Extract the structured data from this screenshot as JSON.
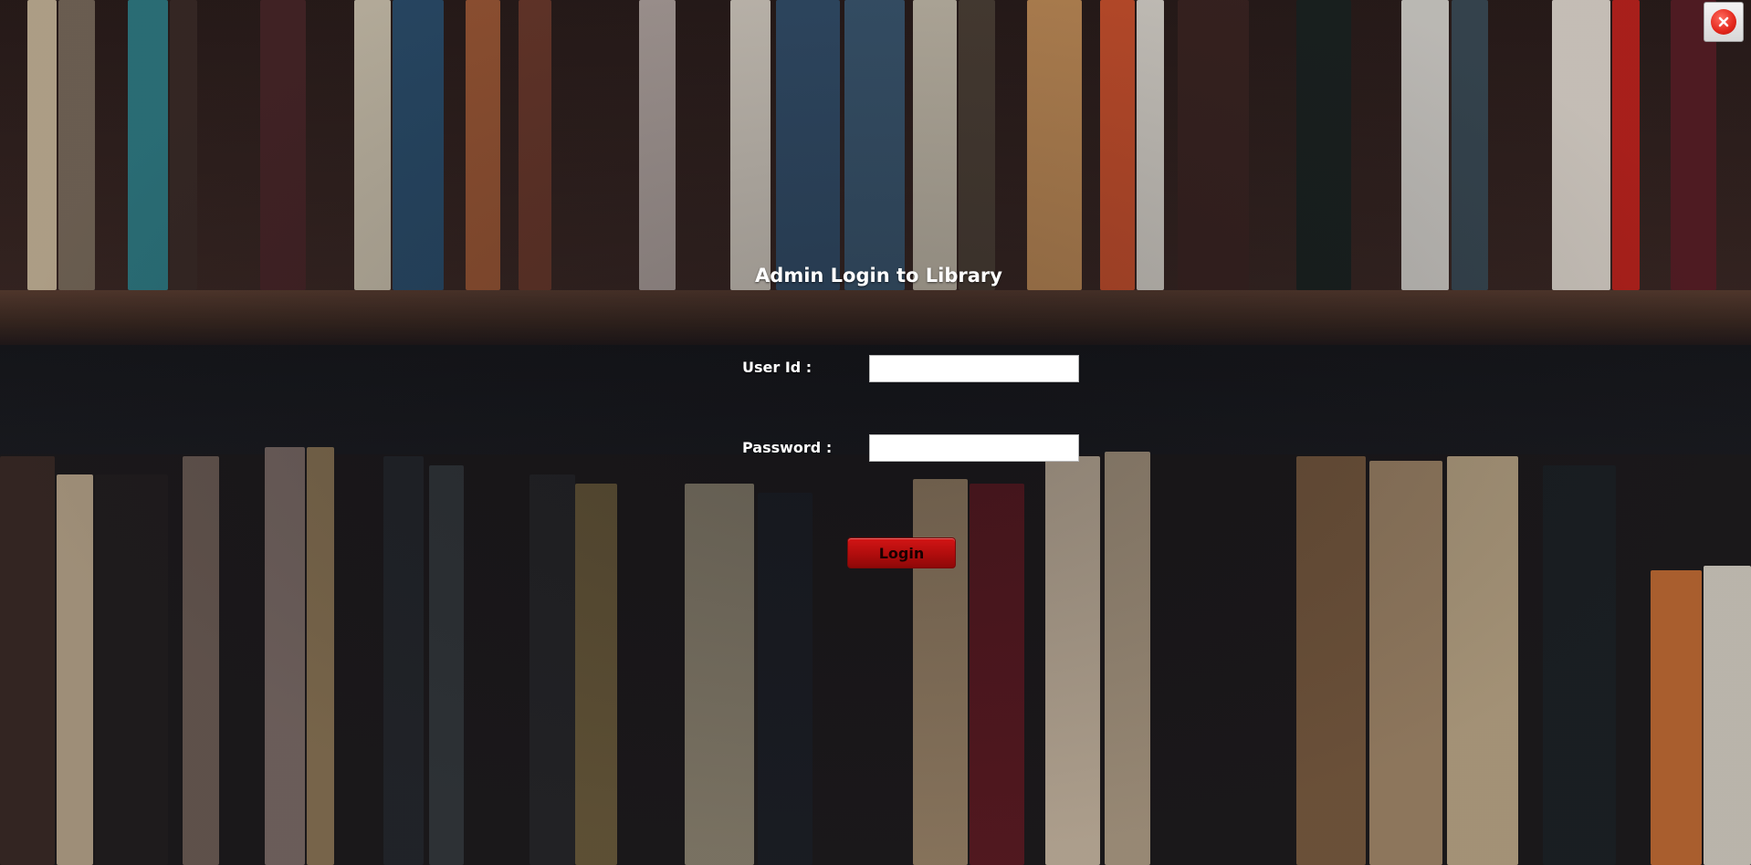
{
  "window": {
    "title": "Admin Login to Library",
    "close_icon": "close-icon"
  },
  "form": {
    "user_id_label": "User Id :",
    "user_id_value": "",
    "password_label": "Password :",
    "password_value": "",
    "login_label": "Login"
  },
  "colors": {
    "login_button": "#c41010",
    "close_button": "#e3271b",
    "text": "#ffffff"
  }
}
